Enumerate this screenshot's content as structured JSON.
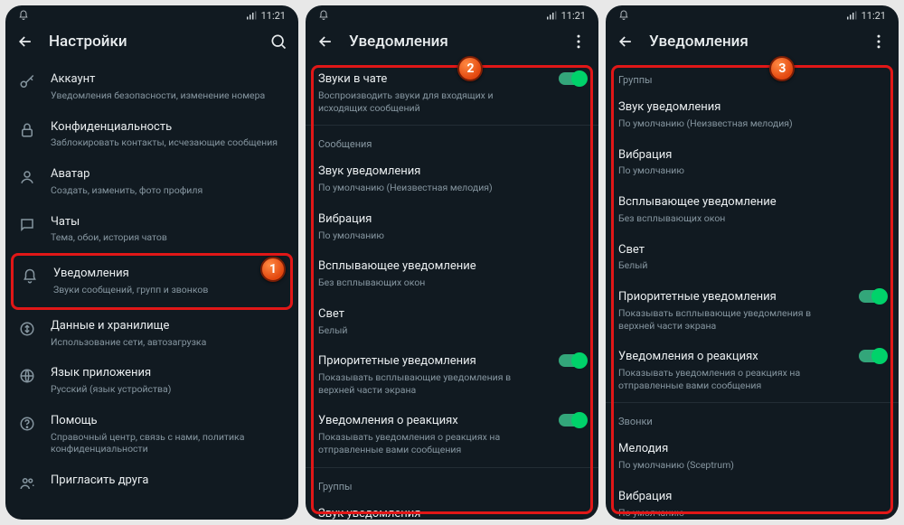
{
  "status": {
    "time": "11:21"
  },
  "screen1": {
    "title": "Настройки",
    "items": [
      {
        "icon": "key",
        "label": "Аккаунт",
        "sub": "Уведомления безопасности, изменение номера"
      },
      {
        "icon": "lock",
        "label": "Конфиденциальность",
        "sub": "Заблокировать контакты, исчезающие сообщения"
      },
      {
        "icon": "avatar",
        "label": "Аватар",
        "sub": "Создать, изменить, фото профиля"
      },
      {
        "icon": "chat",
        "label": "Чаты",
        "sub": "Тема, обои, история чатов"
      },
      {
        "icon": "bell",
        "label": "Уведомления",
        "sub": "Звуки сообщений, групп и звонков"
      },
      {
        "icon": "data",
        "label": "Данные и хранилище",
        "sub": "Использование сети, автозагрузка"
      },
      {
        "icon": "globe",
        "label": "Язык приложения",
        "sub": "Русский (язык устройства)"
      },
      {
        "icon": "help",
        "label": "Помощь",
        "sub": "Справочный центр, связь с нами, политика конфиденциальности"
      },
      {
        "icon": "invite",
        "label": "Пригласить друга",
        "sub": ""
      }
    ]
  },
  "screen2": {
    "title": "Уведомления",
    "top": {
      "label": "Звуки в чате",
      "sub": "Воспроизводить звуки для входящих и исходящих сообщений"
    },
    "sectionMessages": "Сообщения",
    "msgItems": [
      {
        "label": "Звук уведомления",
        "sub": "По умолчанию (Неизвестная мелодия)"
      },
      {
        "label": "Вибрация",
        "sub": "По умолчанию"
      },
      {
        "label": "Всплывающее уведомление",
        "sub": "Без всплывающих окон"
      },
      {
        "label": "Свет",
        "sub": "Белый"
      },
      {
        "label": "Приоритетные уведомления",
        "sub": "Показывать всплывающие уведомления в верхней части экрана",
        "toggle": true
      },
      {
        "label": "Уведомления о реакциях",
        "sub": "Показывать уведомления о реакциях на отправленные вами сообщения",
        "toggle": true
      }
    ],
    "sectionGroups": "Группы",
    "groupPeek": "Звук уведомления"
  },
  "screen3": {
    "title": "Уведомления",
    "sectionGroups": "Группы",
    "groupItems": [
      {
        "label": "Звук уведомления",
        "sub": "По умолчанию (Неизвестная мелодия)"
      },
      {
        "label": "Вибрация",
        "sub": "По умолчанию"
      },
      {
        "label": "Всплывающее уведомление",
        "sub": "Без всплывающих окон"
      },
      {
        "label": "Свет",
        "sub": "Белый"
      },
      {
        "label": "Приоритетные уведомления",
        "sub": "Показывать всплывающие уведомления в верхней части экрана",
        "toggle": true
      },
      {
        "label": "Уведомления о реакциях",
        "sub": "Показывать уведомления о реакциях на отправленные вами сообщения",
        "toggle": true
      }
    ],
    "sectionCalls": "Звонки",
    "callItems": [
      {
        "label": "Мелодия",
        "sub": "По умолчанию (Sceptrum)"
      },
      {
        "label": "Вибрация",
        "sub": "По умолчанию"
      }
    ]
  },
  "markers": {
    "m1": "1",
    "m2": "2",
    "m3": "3"
  }
}
